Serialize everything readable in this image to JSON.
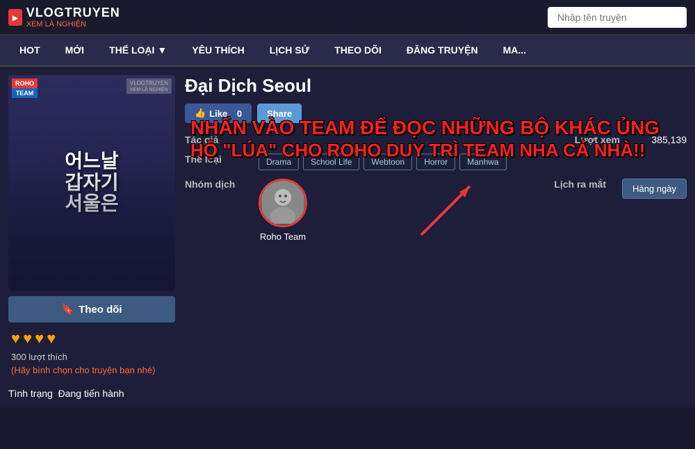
{
  "header": {
    "logo_top": "VLOGTRUYEN",
    "logo_sub": "XEM LÀ NGHIỆN",
    "search_placeholder": "Nhập tên truyện"
  },
  "nav": {
    "items": [
      {
        "label": "HOT",
        "active": false
      },
      {
        "label": "MỚI",
        "active": false
      },
      {
        "label": "THỂ LOẠI",
        "has_dropdown": true,
        "active": false
      },
      {
        "label": "YÊU THÍCH",
        "active": false
      },
      {
        "label": "LỊCH SỬ",
        "active": false
      },
      {
        "label": "THEO DÕI",
        "active": false
      },
      {
        "label": "ĐĂNG TRUYỆN",
        "active": false
      },
      {
        "label": "MA...",
        "active": false
      }
    ]
  },
  "manga": {
    "title": "Đại Dịch Seoul",
    "cover_korean_text": "어느날\n갑자기\n서울은",
    "cover_badge_top": "ROHO",
    "cover_badge_bottom": "TEAM",
    "like_label": "Like",
    "like_count": "0",
    "share_label": "Share",
    "promo_line1": "NHẤN VÀO TEAM ĐỂ ĐỌC NHỮNG BỘ KHÁC ỦNG",
    "promo_line2": "HỘ \"LÚA\" CHO ROHO DUY TRÌ TEAM NHA CẢ NHÀ!!",
    "author_label": "Tác giả",
    "author_value": "",
    "views_label": "Lượt xem",
    "views_value": "385,139",
    "genre_label": "Thể loại",
    "genres": [
      "Drama",
      "School Life",
      "Webtoon",
      "Horror",
      "Manhwa"
    ],
    "translator_label": "Nhóm dịch",
    "translator_name": "Roho Team",
    "schedule_label": "Lịch ra mắt",
    "schedule_value": "Hàng ngày",
    "follow_btn_label": "Theo dõi",
    "hearts_count": 4,
    "rating_count": "300 lượt thích",
    "rating_vote_label": "(Hãy bình chọn cho truyện bạn nhé)",
    "status_label": "Tình trạng",
    "status_value": "Đang tiến hành"
  }
}
